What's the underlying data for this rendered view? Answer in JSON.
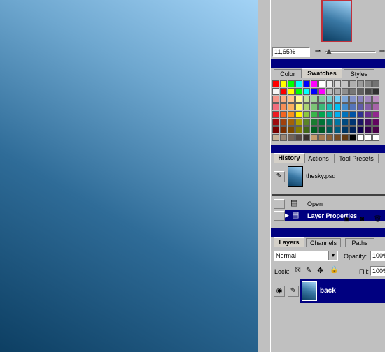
{
  "navigator": {
    "zoom": "11,65%",
    "zoom_out_icon": "mountain-small-icon"
  },
  "color_panel": {
    "tabs": [
      "Color",
      "Swatches",
      "Styles"
    ],
    "active_tab": "Swatches",
    "swatch_rows": [
      [
        "#ff0000",
        "#ffff00",
        "#00ff00",
        "#00ffff",
        "#0000ff",
        "#ff00ff",
        "#ffffff",
        "#ebebeb",
        "#d7d7d7",
        "#c3c3c3",
        "#afafaf",
        "#9b9b9b",
        "#878787",
        "#737373"
      ],
      [
        "#f7f7f7",
        "#ff0000",
        "#ffff00",
        "#00ff00",
        "#00ffff",
        "#0000ff",
        "#ff00ff",
        "#bfbfbf",
        "#a9a9a9",
        "#8f8f8f",
        "#777777",
        "#5f5f5f",
        "#474747",
        "#303030"
      ],
      [
        "#f6968a",
        "#f9ad81",
        "#fdc68a",
        "#fff799",
        "#c4df9b",
        "#a3d39c",
        "#82ca9d",
        "#7bcdc8",
        "#6dcff6",
        "#7ea7d8",
        "#8493ca",
        "#8882be",
        "#a187be",
        "#bc8cbf"
      ],
      [
        "#f26d7d",
        "#f68e56",
        "#fbaf5d",
        "#fff568",
        "#acd373",
        "#7cc576",
        "#3bb878",
        "#1abbb4",
        "#00bff3",
        "#438ccb",
        "#5574b9",
        "#605ca8",
        "#855fa8",
        "#a763a8"
      ],
      [
        "#ed1c24",
        "#f26522",
        "#f7941d",
        "#fff200",
        "#8dc63f",
        "#39b54a",
        "#00a651",
        "#00a99d",
        "#00aeef",
        "#0072bc",
        "#0054a6",
        "#2e3192",
        "#662d91",
        "#92278f"
      ],
      [
        "#9e0b0f",
        "#a0410d",
        "#a36209",
        "#aba000",
        "#598527",
        "#1a7b30",
        "#007236",
        "#00746b",
        "#0076a3",
        "#004a80",
        "#003471",
        "#1b1464",
        "#440e62",
        "#630460"
      ],
      [
        "#790000",
        "#7b2e00",
        "#7d4900",
        "#827b00",
        "#406618",
        "#005e20",
        "#005826",
        "#005952",
        "#005b7f",
        "#003663",
        "#002157",
        "#0d004c",
        "#32004b",
        "#4b0049"
      ],
      [
        "#c7b299",
        "#998675",
        "#736357",
        "#534741",
        "#37302d",
        "#c69c6d",
        "#a67c52",
        "#8c6239",
        "#754c24",
        "#603913",
        "#000000",
        "#ffffff",
        "#ffffff",
        "#ffffff"
      ]
    ]
  },
  "history_panel": {
    "tabs": [
      "History",
      "Actions",
      "Tool Presets"
    ],
    "active_tab": "History",
    "snapshot": "thesky.psd",
    "items": [
      {
        "label": "Open",
        "selected": false
      },
      {
        "label": "Layer Properties",
        "selected": true
      }
    ]
  },
  "layers_panel": {
    "tabs": [
      "Layers",
      "Channels",
      "Paths"
    ],
    "active_tab": "Layers",
    "blend_mode": "Normal",
    "opacity_label": "Opacity:",
    "opacity_value": "100%",
    "lock_label": "Lock:",
    "fill_label": "Fill:",
    "fill_value": "100%",
    "layers": [
      {
        "name": "back",
        "selected": true
      }
    ]
  }
}
